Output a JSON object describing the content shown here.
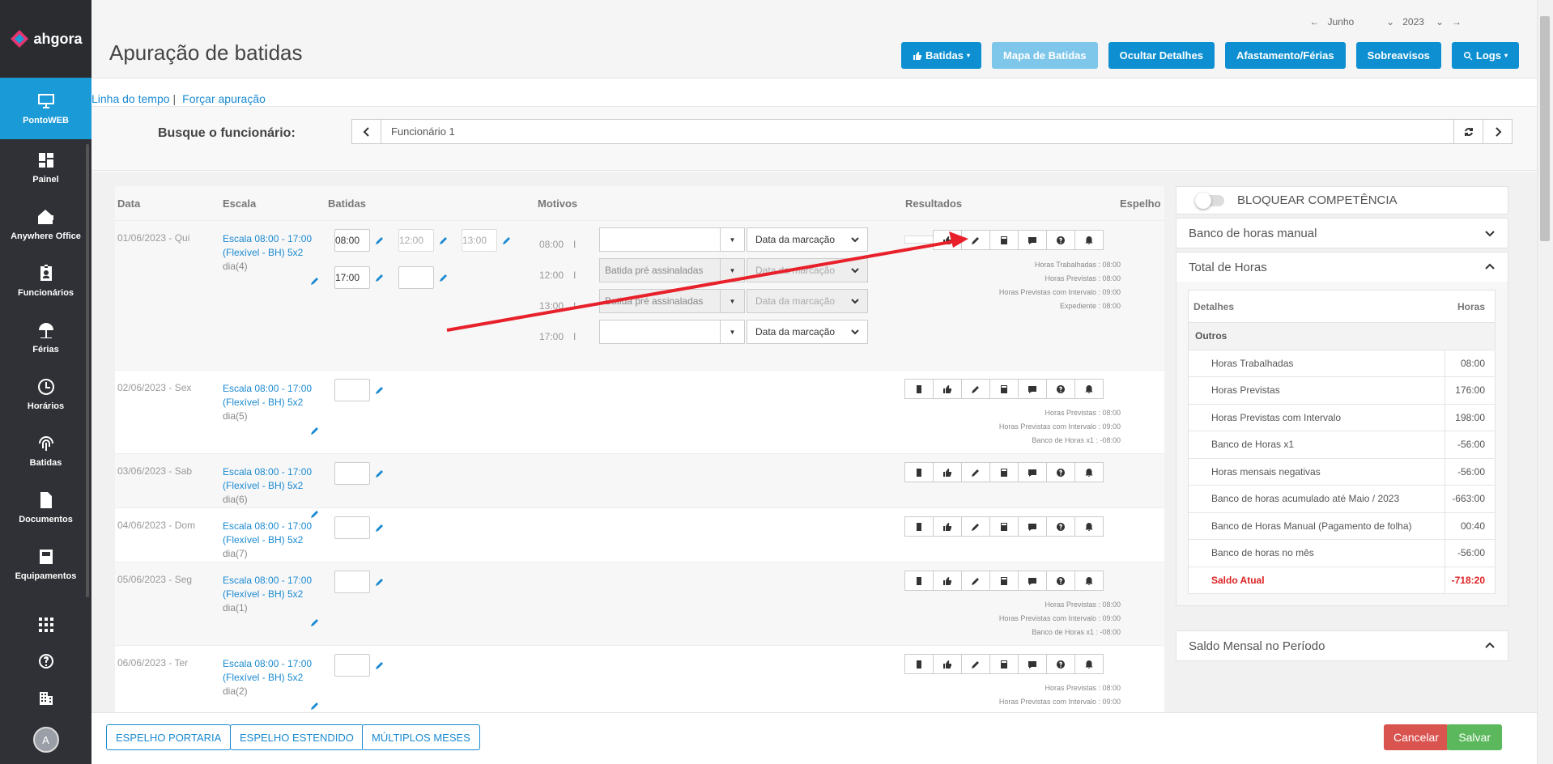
{
  "brand": {
    "name": "ahgora"
  },
  "sidebar": {
    "items": [
      {
        "label": "PontoWEB",
        "icon": "monitor-icon"
      },
      {
        "label": "Painel",
        "icon": "dashboard-icon"
      },
      {
        "label": "Anywhere Office",
        "icon": "home-office-icon"
      },
      {
        "label": "Funcionários",
        "icon": "id-badge-icon"
      },
      {
        "label": "Férias",
        "icon": "beach-umbrella-icon"
      },
      {
        "label": "Horários",
        "icon": "clock-icon"
      },
      {
        "label": "Batidas",
        "icon": "fingerprint-icon"
      },
      {
        "label": "Documentos",
        "icon": "document-icon"
      },
      {
        "label": "Equipamentos",
        "icon": "device-icon"
      }
    ],
    "avatar": "A"
  },
  "header": {
    "title": "Apuração de batidas",
    "month": "Junho",
    "year": "2023",
    "buttons": {
      "batidas": "Batidas",
      "mapa": "Mapa de Batidas",
      "ocultar": "Ocultar Detalhes",
      "afastamento": "Afastamento/Férias",
      "sobreavisos": "Sobreavisos",
      "logs": "Logs"
    }
  },
  "breadcrumb": {
    "timeline": "Linha do tempo",
    "sep": "|",
    "force": "Forçar apuração"
  },
  "search": {
    "label": "Busque o funcionário:",
    "value": "Funcionário 1"
  },
  "table": {
    "headers": {
      "data": "Data",
      "escala": "Escala",
      "batidas": "Batidas",
      "motivos": "Motivos",
      "resultados": "Resultados",
      "espelho": "Espelho"
    },
    "scale_line1": "Escala 08:00 - 17:00",
    "scale_line2": "(Flexível - BH) 5x2",
    "rows": [
      {
        "date": "01/06/2023 - Qui",
        "dia": "dia(4)",
        "punches": [
          "08:00",
          "12:00",
          "13:00",
          "17:00",
          ""
        ],
        "motives": [
          {
            "time": "08:00",
            "sep": "I",
            "text": "",
            "date": "Data da marcação"
          },
          {
            "time": "12:00",
            "sep": "I",
            "text": "Batida pré assinaladas",
            "date": "Data da marcação"
          },
          {
            "time": "13:00",
            "sep": "I",
            "text": "Batida pré assinaladas",
            "date": "Data da marcação"
          },
          {
            "time": "17:00",
            "sep": "I",
            "text": "",
            "date": "Data da marcação"
          }
        ],
        "results": [
          "Horas Trabalhadas : 08:00",
          "Horas Previstas : 08:00",
          "Horas Previstas com Intervalo : 09:00",
          "Expediente : 08:00"
        ]
      },
      {
        "date": "02/06/2023 - Sex",
        "dia": "dia(5)",
        "punches": [
          ""
        ],
        "results": [
          "Horas Previstas : 08:00",
          "Horas Previstas com Intervalo : 09:00",
          "Banco de Horas x1 : -08:00"
        ]
      },
      {
        "date": "03/06/2023 - Sab",
        "dia": "dia(6)",
        "punches": [
          ""
        ],
        "results": []
      },
      {
        "date": "04/06/2023 - Dom",
        "dia": "dia(7)",
        "punches": [
          ""
        ],
        "results": []
      },
      {
        "date": "05/06/2023 - Seg",
        "dia": "dia(1)",
        "punches": [
          ""
        ],
        "results": [
          "Horas Previstas : 08:00",
          "Horas Previstas com Intervalo : 09:00",
          "Banco de Horas x1 : -08:00"
        ]
      },
      {
        "date": "06/06/2023 - Ter",
        "dia": "dia(2)",
        "punches": [
          ""
        ],
        "results": [
          "Horas Previstas : 08:00",
          "Horas Previstas com Intervalo : 09:00"
        ]
      }
    ]
  },
  "right_panel": {
    "lock": "BLOQUEAR COMPETÊNCIA",
    "manual_bank": "Banco de horas manual",
    "total_hours": "Total de Horas",
    "details_header": "Detalhes",
    "hours_header": "Horas",
    "group": "Outros",
    "items": [
      {
        "label": "Horas Trabalhadas",
        "value": "08:00"
      },
      {
        "label": "Horas Previstas",
        "value": "176:00"
      },
      {
        "label": "Horas Previstas com Intervalo",
        "value": "198:00"
      },
      {
        "label": "Banco de Horas x1",
        "value": "-56:00"
      },
      {
        "label": "Horas mensais negativas",
        "value": "-56:00"
      },
      {
        "label": "Banco de horas acumulado até Maio / 2023",
        "value": "-663:00"
      },
      {
        "label": "Banco de Horas Manual (Pagamento de folha)",
        "value": "00:40"
      },
      {
        "label": "Banco de horas no mês",
        "value": "-56:00"
      }
    ],
    "saldo_label": "Saldo Atual",
    "saldo_value": "-718:20",
    "monthly": "Saldo Mensal no Período"
  },
  "footer": {
    "espelho_portaria": "ESPELHO PORTARIA",
    "espelho_estendido": "ESPELHO ESTENDIDO",
    "multiplos": "MÚLTIPLOS MESES",
    "cancel": "Cancelar",
    "save": "Salvar"
  },
  "colors": {
    "primary": "#0d8fd1",
    "sidebar": "#2f3136",
    "danger": "#d9534f",
    "success": "#5cb85c",
    "annotation": "#e8202a"
  }
}
